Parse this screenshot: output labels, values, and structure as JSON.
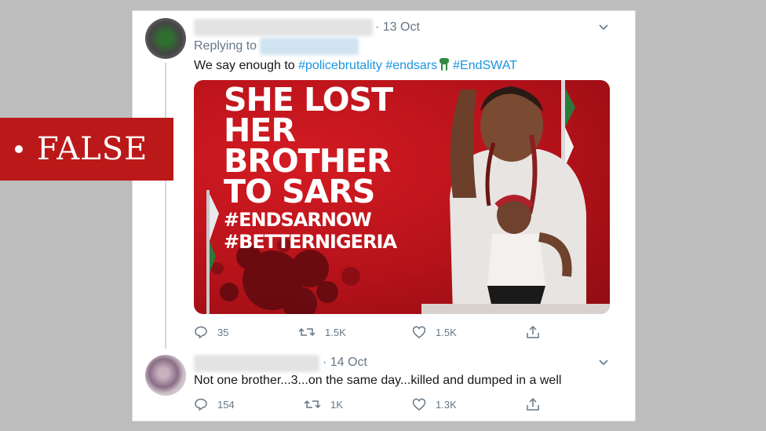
{
  "verdict": {
    "label": "FALSE"
  },
  "tweet1": {
    "date": "· 13 Oct",
    "replying_to": "Replying to",
    "text_prefix": "We say enough to ",
    "hashtags": [
      "#policebrutality",
      "#endsars",
      "#EndSWAT"
    ],
    "media": {
      "headline": [
        "SHE LOST",
        "HER",
        "BROTHER",
        "TO SARS"
      ],
      "tags": [
        "#ENDSARNOW",
        "#BETTERNIGERIA"
      ]
    },
    "actions": {
      "replies": "35",
      "retweets": "1.5K",
      "likes": "1.5K"
    }
  },
  "tweet2": {
    "date": "· 14 Oct",
    "text": "Not one brother...3...on the same day...killed and dumped in a well",
    "actions": {
      "replies": "154",
      "retweets": "1K",
      "likes": "1.3K"
    }
  },
  "colors": {
    "link": "#1b95e0",
    "verdict_bg": "#bb1919",
    "media_red": "#c8161d",
    "meta": "#657786"
  },
  "icons": [
    "reply-icon",
    "retweet-icon",
    "like-icon",
    "share-icon",
    "chevron-down-icon",
    "raised-fist-icon"
  ]
}
